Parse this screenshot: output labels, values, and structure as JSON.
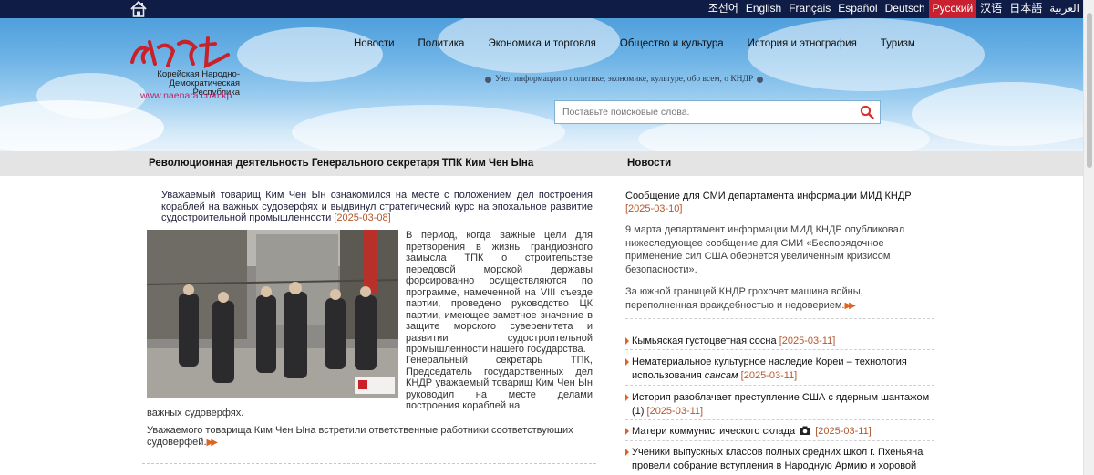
{
  "topbar": {
    "languages": [
      "조선어",
      "English",
      "Français",
      "Español",
      "Deutsch",
      "Русский",
      "汉语",
      "日本語",
      "العربية"
    ],
    "active_language": "Русский",
    "active_color": "#c8202e",
    "bar_color": "#0f1c46"
  },
  "logo": {
    "line1": "Корейская Народно-",
    "line2": "Демократическая Республика",
    "url": "www.naenara.com.kp"
  },
  "nav": [
    "Новости",
    "Политика",
    "Экономика и торговля",
    "Общество и культура",
    "История и этнография",
    "Туризм"
  ],
  "tagline": "Узел информации о политике, экономике, культуре, обо всем, о КНДР",
  "search": {
    "placeholder": "Поставьте поисковые слова."
  },
  "left": {
    "section_title": "Революционная деятельность Генерального секретаря ТПК Ким Чен Ына",
    "lead_title": "Уважаемый товарищ Ким Чен Ын ознакомился на месте с положением дел построения кораблей на важных судоверфях и выдвинул стратегический курс на эпохальное развитие судостроительной промышленности",
    "lead_date": "[2025-03-08]",
    "para1": "В период, когда важные цели для претворения в жизнь грандиозного замысла ТПК о строительстве передовой морской державы форсированно осуществляются по программе, намеченной на VIII съезде партии, проведено руководство ЦК партии, имеющее заметное значение в защите морского суверенитета и развитии судостроительной промышленности нашего государства.",
    "para2": "Генеральный секретарь ТПК, Председатель государственных дел КНДР уважаемый товарищ Ким Чен Ын руководил на месте делами построения кораблей на",
    "para2_tail": "важных судоверфях.",
    "para3": "Уважаемого товарища Ким Чен Ына встретили ответственные работники соответствующих судоверфей."
  },
  "right": {
    "section_title": "Новости",
    "top_news": {
      "title": "Сообщение для СМИ департамента информации МИД КНДР",
      "date": "[2025-03-10]",
      "body1": "9 марта департамент информации МИД КНДР опубликовал нижеследующее сообщение для СМИ «Беспорядочное применение сил США обернется увеличенным кризисом безопасности».",
      "body2": "За южной границей КНДР грохочет машина войны, переполненная враждебностью и недоверием."
    },
    "items": [
      {
        "text": "Кымьяская густоцветная сосна",
        "date": "[2025-03-11]"
      },
      {
        "text": "Нематериальное культурное наследие Кореи – технология использования",
        "italic": "сансам",
        "date": "[2025-03-11]"
      },
      {
        "text": "История разоблачает преступление США с ядерным шантажом (1)",
        "date": "[2025-03-11]"
      },
      {
        "text": "Матери коммунистического склада",
        "date": "[2025-03-11]"
      },
      {
        "text": "Ученики выпускных классов полных средних школ г. Пхеньяна провели собрание вступления в Народную Армию и хоровой"
      }
    ]
  }
}
